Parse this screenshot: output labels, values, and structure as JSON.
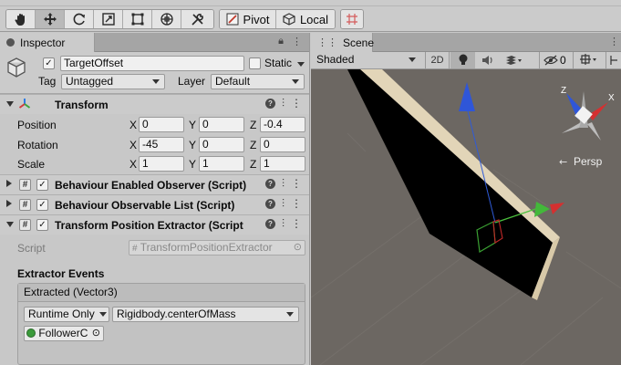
{
  "toolbar": {
    "tools": [
      {
        "name": "hand-tool",
        "icon": "hand-icon"
      },
      {
        "name": "move-tool",
        "icon": "move-arrows-icon"
      },
      {
        "name": "rotate-tool",
        "icon": "rotate-icon"
      },
      {
        "name": "scale-tool",
        "icon": "scale-icon"
      },
      {
        "name": "rect-tool",
        "icon": "rect-icon"
      },
      {
        "name": "transform-tool",
        "icon": "transform-icon"
      },
      {
        "name": "custom-tool",
        "icon": "tools-icon"
      }
    ],
    "pivot_label": "Pivot",
    "local_label": "Local",
    "snap_icon": "grid-snap-icon"
  },
  "inspector": {
    "tab_label": "Inspector",
    "object": {
      "name": "TargetOffset",
      "active": true,
      "static_label": "Static",
      "static_checked": false,
      "tag_label": "Tag",
      "tag_value": "Untagged",
      "layer_label": "Layer",
      "layer_value": "Default"
    },
    "transform": {
      "title": "Transform",
      "rows": [
        {
          "label": "Position",
          "x": "0",
          "y": "0",
          "z": "-0.4"
        },
        {
          "label": "Rotation",
          "x": "-45",
          "y": "0",
          "z": "0"
        },
        {
          "label": "Scale",
          "x": "1",
          "y": "1",
          "z": "1"
        }
      ],
      "axis_x": "X",
      "axis_y": "Y",
      "axis_z": "Z"
    },
    "components": [
      {
        "title": "Behaviour Enabled Observer (Script)",
        "enabled": true,
        "expanded": false
      },
      {
        "title": "Behaviour Observable List (Script)",
        "enabled": true,
        "expanded": false
      },
      {
        "title": "Transform Position Extractor (Script",
        "enabled": true,
        "expanded": true
      }
    ],
    "extractor": {
      "script_label": "Script",
      "script_value": "TransformPositionExtractor",
      "events_label": "Extractor Events",
      "event_header": "Extracted (Vector3)",
      "runtime_value": "Runtime Only",
      "function_value": "Rigidbody.centerOfMass",
      "target_value": "FollowerC"
    }
  },
  "scene": {
    "tab_label": "Scene",
    "shading_value": "Shaded",
    "mode_2d": "2D",
    "hidden_count": "0",
    "persp_label": "Persp",
    "gizmo_axis_x": "X",
    "gizmo_axis_z": "Z"
  }
}
